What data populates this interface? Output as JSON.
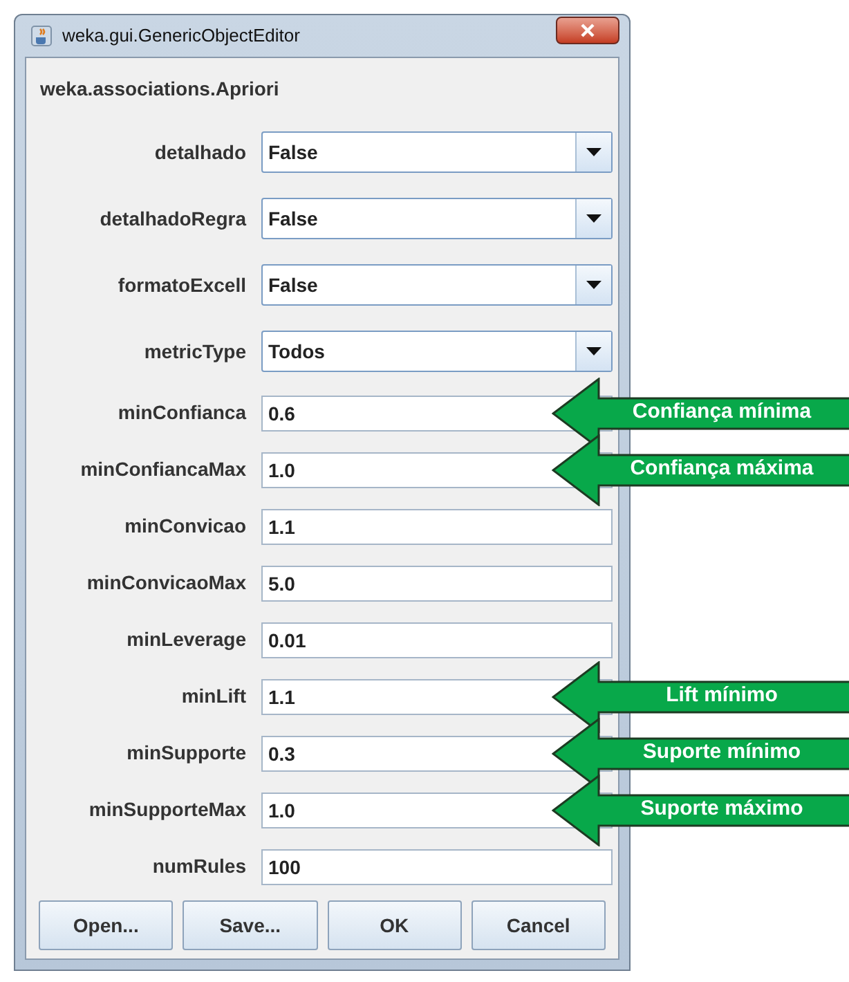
{
  "window": {
    "title": "weka.gui.GenericObjectEditor"
  },
  "object_name": "weka.associations.Apriori",
  "properties": [
    {
      "label": "detalhado",
      "kind": "dropdown",
      "value": "False"
    },
    {
      "label": "detalhadoRegra",
      "kind": "dropdown",
      "value": "False"
    },
    {
      "label": "formatoExcell",
      "kind": "dropdown",
      "value": "False"
    },
    {
      "label": "metricType",
      "kind": "dropdown",
      "value": "Todos"
    },
    {
      "label": "minConfianca",
      "kind": "text",
      "value": "0.6",
      "annotation": "Confiança mínima"
    },
    {
      "label": "minConfiancaMax",
      "kind": "text",
      "value": "1.0",
      "annotation": "Confiança máxima"
    },
    {
      "label": "minConvicao",
      "kind": "text",
      "value": "1.1"
    },
    {
      "label": "minConvicaoMax",
      "kind": "text",
      "value": "5.0"
    },
    {
      "label": "minLeverage",
      "kind": "text",
      "value": "0.01"
    },
    {
      "label": "minLift",
      "kind": "text",
      "value": "1.1",
      "annotation": "Lift mínimo"
    },
    {
      "label": "minSupporte",
      "kind": "text",
      "value": "0.3",
      "annotation": "Suporte mínimo"
    },
    {
      "label": "minSupporteMax",
      "kind": "text",
      "value": "1.0",
      "annotation": "Suporte máximo"
    },
    {
      "label": "numRules",
      "kind": "text",
      "value": "100"
    }
  ],
  "buttons": [
    "Open...",
    "Save...",
    "OK",
    "Cancel"
  ]
}
